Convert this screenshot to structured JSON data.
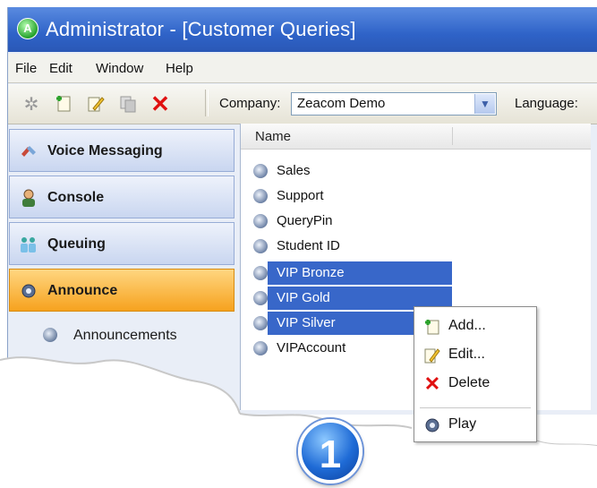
{
  "window": {
    "title": "Administrator - [Customer Queries]",
    "app_icon": "A"
  },
  "menu": [
    "File",
    "Edit",
    "Window",
    "Help"
  ],
  "toolbar": {
    "icons": [
      "wand-icon",
      "add-icon",
      "edit-icon",
      "copy-icon",
      "delete-icon"
    ],
    "company_label": "Company:",
    "company_value": "Zeacom Demo",
    "language_label": "Language:"
  },
  "nav": {
    "items": [
      {
        "label": "Voice Messaging",
        "icon": "voice-messaging-icon"
      },
      {
        "label": "Console",
        "icon": "console-icon"
      },
      {
        "label": "Queuing",
        "icon": "queuing-icon"
      },
      {
        "label": "Announce",
        "icon": "announce-icon",
        "active": true
      }
    ],
    "subitems": [
      {
        "label": "Announcements"
      }
    ]
  },
  "list": {
    "column_header": "Name",
    "rows": [
      {
        "label": "Sales",
        "selected": false
      },
      {
        "label": "Support",
        "selected": false
      },
      {
        "label": "QueryPin",
        "selected": false
      },
      {
        "label": "Student ID",
        "selected": false
      },
      {
        "label": "VIP Bronze",
        "selected": true
      },
      {
        "label": "VIP Gold",
        "selected": true
      },
      {
        "label": "VIP Silver",
        "selected": true
      },
      {
        "label": "VIPAccount",
        "selected": false
      }
    ]
  },
  "context_menu": {
    "items": [
      {
        "label": "Add...",
        "icon": "add-icon"
      },
      {
        "label": "Edit...",
        "icon": "edit-icon"
      },
      {
        "label": "Delete",
        "icon": "delete-icon"
      },
      {
        "label": "Play",
        "icon": "play-icon"
      }
    ]
  },
  "callout": {
    "number": "1"
  },
  "colors": {
    "titlebar": "#2f63c8",
    "selection": "#3867c9",
    "active_nav": "#f6a21e",
    "delete": "#e01010"
  }
}
